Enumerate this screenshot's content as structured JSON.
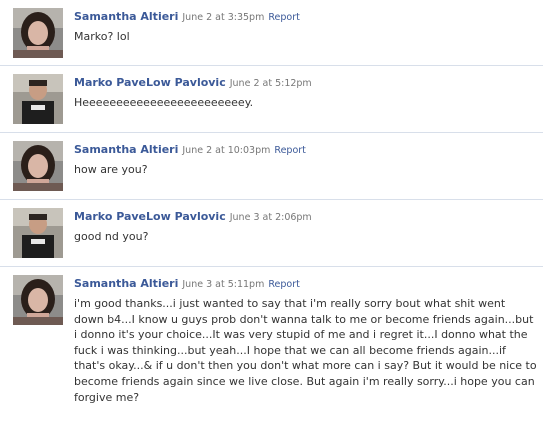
{
  "posts": [
    {
      "author": "Samantha Altieri",
      "date": "June 2 at 3:35pm",
      "report": "Report",
      "text": "Marko? lol"
    },
    {
      "author": "Marko PaveLow Pavlovic",
      "date": "June 2 at 5:12pm",
      "report": "",
      "text": "Heeeeeeeeeeeeeeeeeeeeeeeey."
    },
    {
      "author": "Samantha Altieri",
      "date": "June 2 at 10:03pm",
      "report": "Report",
      "text": "how are you?"
    },
    {
      "author": "Marko PaveLow Pavlovic",
      "date": "June 3 at 2:06pm",
      "report": "",
      "text": "good nd you?"
    },
    {
      "author": "Samantha Altieri",
      "date": "June 3 at 5:11pm",
      "report": "Report",
      "text": "i'm good thanks...i just wanted to say that i'm really sorry bout what shit went down b4...I know u guys prob don't wanna talk to me or become friends again...but i donno it's your choice...It was very stupid of me and i regret it...I donno what the fuck i was thinking...but yeah...I hope that we can all become friends again...if that's okay...& if u don't then you don't what more can i say? But it would be nice to become friends again since we live close. But again i'm really sorry...i hope you can forgive me?"
    }
  ],
  "colors": {
    "link": "#3b5998",
    "meta": "#777777",
    "divider": "#d8dfea",
    "text": "#333333"
  }
}
